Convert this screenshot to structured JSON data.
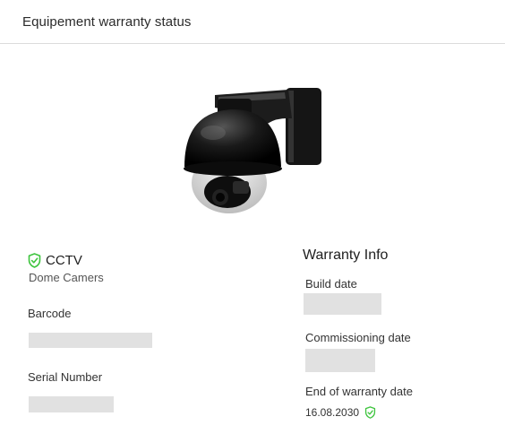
{
  "header": {
    "title": "Equipement warranty status"
  },
  "equipment": {
    "name": "CCTV",
    "type": "Dome Camers",
    "status_icon": "shield-check-icon",
    "status_color": "#3ec43e"
  },
  "fields": {
    "barcode_label": "Barcode",
    "serial_label": "Serial Number"
  },
  "warranty": {
    "title": "Warranty Info",
    "build_date_label": "Build date",
    "commissioning_date_label": "Commissioning date",
    "end_of_warranty_label": "End of warranty date",
    "end_of_warranty_value": "16.08.2030",
    "end_of_warranty_icon": "shield-check-icon"
  }
}
